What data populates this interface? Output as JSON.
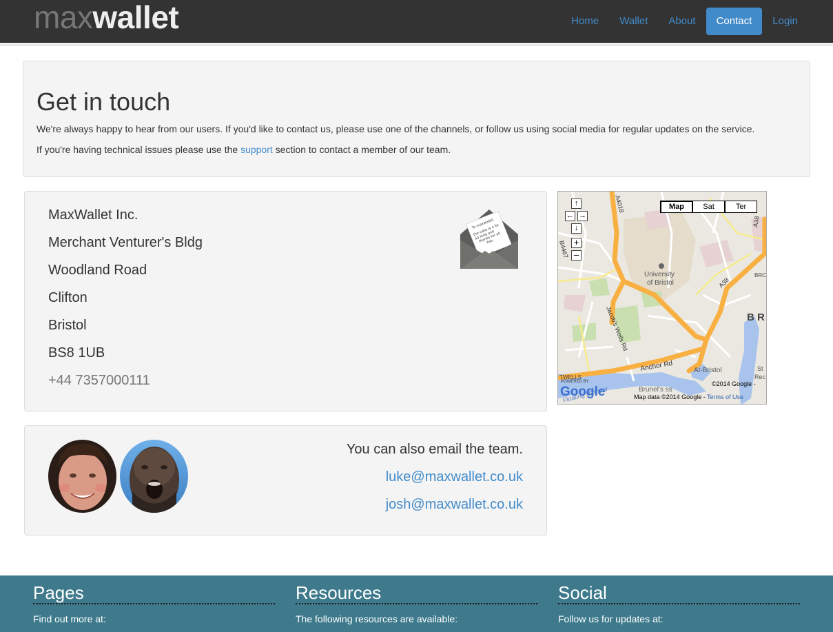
{
  "nav": {
    "brand_light": "max",
    "brand_bold": "wallet",
    "items": [
      {
        "label": "Home"
      },
      {
        "label": "Wallet"
      },
      {
        "label": "About"
      },
      {
        "label": "Contact",
        "active": true
      },
      {
        "label": "Login"
      }
    ]
  },
  "jumbotron": {
    "title": "Get in touch",
    "paragraph1": "We're always happy to hear from our users. If you'd like to contact us, please use one of the channels, or follow us using social media for regular updates on the service.",
    "paragraph2_before": "If you're having technical issues please use the ",
    "paragraph2_link": "support",
    "paragraph2_after": " section to contact a member of our team."
  },
  "address": {
    "lines": [
      "MaxWallet Inc.",
      "Merchant Venturer's Bldg",
      "Woodland Road",
      "Clifton",
      "Bristol",
      "BS8 1UB"
    ],
    "phone": "+44 7357000111",
    "envelope_note": "To maxwallet, the cake is a lie. So long and thanks for all the fish."
  },
  "map": {
    "type_buttons": [
      "Map",
      "Sat",
      "Ter"
    ],
    "active_type": "Map",
    "labels": {
      "university": "University",
      "university2": "of Bristol",
      "a4018": "A4018",
      "a38_top": "A38",
      "a38_mid": "A38",
      "b4467": "B4467",
      "jacobs": "Jacob's Wells Rd",
      "anchor": "Anchor Rd",
      "atbristol": "At-Bristol",
      "brunels": "Brunel's ss",
      "br": "B R",
      "brc": "BRC",
      "st": "St",
      "rec": "Rec",
      "twells": "TWELLS",
      "floating": "Floating Harbour",
      "powered": "POWERED BY",
      "google": "Google",
      "copyright": "©2014 Google -",
      "mapdata": "Map data ©2014 Google - ",
      "terms": "Terms of Use"
    }
  },
  "team": {
    "intro": "You can also email the team.",
    "emails": [
      "luke@maxwallet.co.uk",
      "josh@maxwallet.co.uk"
    ]
  },
  "footer": {
    "columns": [
      {
        "title": "Pages",
        "text": "Find out more at:"
      },
      {
        "title": "Resources",
        "text": "The following resources are available:"
      },
      {
        "title": "Social",
        "text": "Follow us for updates at:"
      }
    ]
  },
  "colors": {
    "navbar": "#333333",
    "link": "#428bca",
    "well": "#f4f4f4",
    "footer": "#3e7a8c"
  }
}
